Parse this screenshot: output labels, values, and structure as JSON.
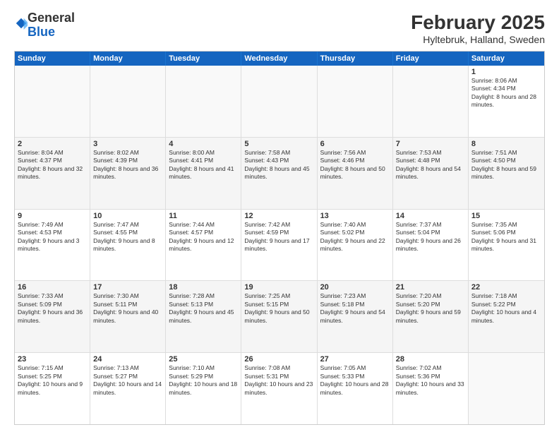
{
  "header": {
    "logo_general": "General",
    "logo_blue": "Blue",
    "title": "February 2025",
    "subtitle": "Hyltebruk, Halland, Sweden"
  },
  "weekdays": [
    "Sunday",
    "Monday",
    "Tuesday",
    "Wednesday",
    "Thursday",
    "Friday",
    "Saturday"
  ],
  "rows": [
    [
      {
        "day": "",
        "info": ""
      },
      {
        "day": "",
        "info": ""
      },
      {
        "day": "",
        "info": ""
      },
      {
        "day": "",
        "info": ""
      },
      {
        "day": "",
        "info": ""
      },
      {
        "day": "",
        "info": ""
      },
      {
        "day": "1",
        "info": "Sunrise: 8:06 AM\nSunset: 4:34 PM\nDaylight: 8 hours and 28 minutes."
      }
    ],
    [
      {
        "day": "2",
        "info": "Sunrise: 8:04 AM\nSunset: 4:37 PM\nDaylight: 8 hours and 32 minutes."
      },
      {
        "day": "3",
        "info": "Sunrise: 8:02 AM\nSunset: 4:39 PM\nDaylight: 8 hours and 36 minutes."
      },
      {
        "day": "4",
        "info": "Sunrise: 8:00 AM\nSunset: 4:41 PM\nDaylight: 8 hours and 41 minutes."
      },
      {
        "day": "5",
        "info": "Sunrise: 7:58 AM\nSunset: 4:43 PM\nDaylight: 8 hours and 45 minutes."
      },
      {
        "day": "6",
        "info": "Sunrise: 7:56 AM\nSunset: 4:46 PM\nDaylight: 8 hours and 50 minutes."
      },
      {
        "day": "7",
        "info": "Sunrise: 7:53 AM\nSunset: 4:48 PM\nDaylight: 8 hours and 54 minutes."
      },
      {
        "day": "8",
        "info": "Sunrise: 7:51 AM\nSunset: 4:50 PM\nDaylight: 8 hours and 59 minutes."
      }
    ],
    [
      {
        "day": "9",
        "info": "Sunrise: 7:49 AM\nSunset: 4:53 PM\nDaylight: 9 hours and 3 minutes."
      },
      {
        "day": "10",
        "info": "Sunrise: 7:47 AM\nSunset: 4:55 PM\nDaylight: 9 hours and 8 minutes."
      },
      {
        "day": "11",
        "info": "Sunrise: 7:44 AM\nSunset: 4:57 PM\nDaylight: 9 hours and 12 minutes."
      },
      {
        "day": "12",
        "info": "Sunrise: 7:42 AM\nSunset: 4:59 PM\nDaylight: 9 hours and 17 minutes."
      },
      {
        "day": "13",
        "info": "Sunrise: 7:40 AM\nSunset: 5:02 PM\nDaylight: 9 hours and 22 minutes."
      },
      {
        "day": "14",
        "info": "Sunrise: 7:37 AM\nSunset: 5:04 PM\nDaylight: 9 hours and 26 minutes."
      },
      {
        "day": "15",
        "info": "Sunrise: 7:35 AM\nSunset: 5:06 PM\nDaylight: 9 hours and 31 minutes."
      }
    ],
    [
      {
        "day": "16",
        "info": "Sunrise: 7:33 AM\nSunset: 5:09 PM\nDaylight: 9 hours and 36 minutes."
      },
      {
        "day": "17",
        "info": "Sunrise: 7:30 AM\nSunset: 5:11 PM\nDaylight: 9 hours and 40 minutes."
      },
      {
        "day": "18",
        "info": "Sunrise: 7:28 AM\nSunset: 5:13 PM\nDaylight: 9 hours and 45 minutes."
      },
      {
        "day": "19",
        "info": "Sunrise: 7:25 AM\nSunset: 5:15 PM\nDaylight: 9 hours and 50 minutes."
      },
      {
        "day": "20",
        "info": "Sunrise: 7:23 AM\nSunset: 5:18 PM\nDaylight: 9 hours and 54 minutes."
      },
      {
        "day": "21",
        "info": "Sunrise: 7:20 AM\nSunset: 5:20 PM\nDaylight: 9 hours and 59 minutes."
      },
      {
        "day": "22",
        "info": "Sunrise: 7:18 AM\nSunset: 5:22 PM\nDaylight: 10 hours and 4 minutes."
      }
    ],
    [
      {
        "day": "23",
        "info": "Sunrise: 7:15 AM\nSunset: 5:25 PM\nDaylight: 10 hours and 9 minutes."
      },
      {
        "day": "24",
        "info": "Sunrise: 7:13 AM\nSunset: 5:27 PM\nDaylight: 10 hours and 14 minutes."
      },
      {
        "day": "25",
        "info": "Sunrise: 7:10 AM\nSunset: 5:29 PM\nDaylight: 10 hours and 18 minutes."
      },
      {
        "day": "26",
        "info": "Sunrise: 7:08 AM\nSunset: 5:31 PM\nDaylight: 10 hours and 23 minutes."
      },
      {
        "day": "27",
        "info": "Sunrise: 7:05 AM\nSunset: 5:33 PM\nDaylight: 10 hours and 28 minutes."
      },
      {
        "day": "28",
        "info": "Sunrise: 7:02 AM\nSunset: 5:36 PM\nDaylight: 10 hours and 33 minutes."
      },
      {
        "day": "",
        "info": ""
      }
    ]
  ]
}
